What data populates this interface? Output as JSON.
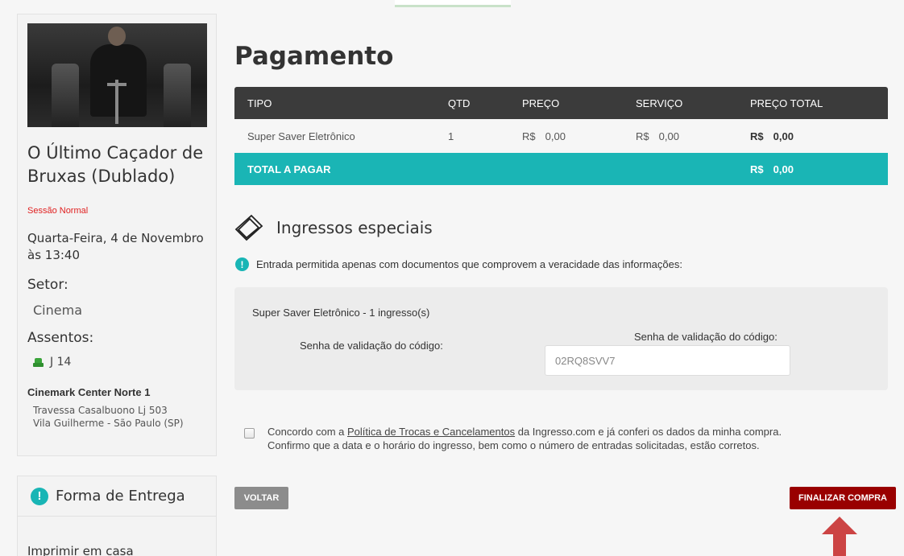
{
  "sidebar": {
    "movie_title": "O Último Caçador de Bruxas (Dublado)",
    "session_type": "Sessão Normal",
    "session_datetime": "Quarta-Feira, 4 de Novembro às 13:40",
    "sector_label": "Setor:",
    "sector_value": "Cinema",
    "seats_label": "Assentos:",
    "seat_value": "J 14",
    "cinema_name": "Cinemark Center Norte 1",
    "cinema_address": "Travessa Casalbuono  Lj 503 Vila Guilherme - São Paulo (SP)",
    "delivery": {
      "title": "Forma de Entrega",
      "info_icon_glyph": "!",
      "option": "Imprimir em casa"
    }
  },
  "main": {
    "title": "Pagamento",
    "table": {
      "headers": [
        "TIPO",
        "QTD",
        "PREÇO",
        "SERVIÇO",
        "PREÇO TOTAL"
      ],
      "row": {
        "type": "Super Saver Eletrônico",
        "qty": "1",
        "price_currency": "R$",
        "price": "0,00",
        "service_currency": "R$",
        "service": "0,00",
        "total_currency": "R$",
        "total": "0,00"
      },
      "footer": {
        "label": "TOTAL A PAGAR",
        "currency": "R$",
        "amount": "0,00"
      }
    },
    "special": {
      "title": "Ingressos especiais",
      "icon": "ticket-icon",
      "notice": "Entrada permitida apenas com documentos que comprovem a veracidade das informações:",
      "notice_icon_glyph": "!"
    },
    "validation": {
      "ticket_description": "Super Saver Eletrônico - 1 ingresso(s)",
      "label_left": "Senha de validação do código:",
      "label_right": "Senha de validação do código:",
      "code_value": "02RQ8SVV7"
    },
    "terms": {
      "prefix": "Concordo com a ",
      "link_text": "Política de Trocas e Cancelamentos",
      "suffix": " da Ingresso.com e já conferi os dados da minha compra.",
      "line2": "Confirmo que a data e o horário do ingresso, bem como o número de entradas solicitadas, estão corretos."
    },
    "buttons": {
      "back": "VOLTAR",
      "finish": "FINALIZAR COMPRA"
    }
  },
  "colors": {
    "accent_teal": "#1ab5b5",
    "header_dark": "#3b3b3b",
    "finish_red": "#990000",
    "back_gray": "#8c8c8c",
    "session_red": "#e02020",
    "arrow_red": "#cc4444"
  }
}
